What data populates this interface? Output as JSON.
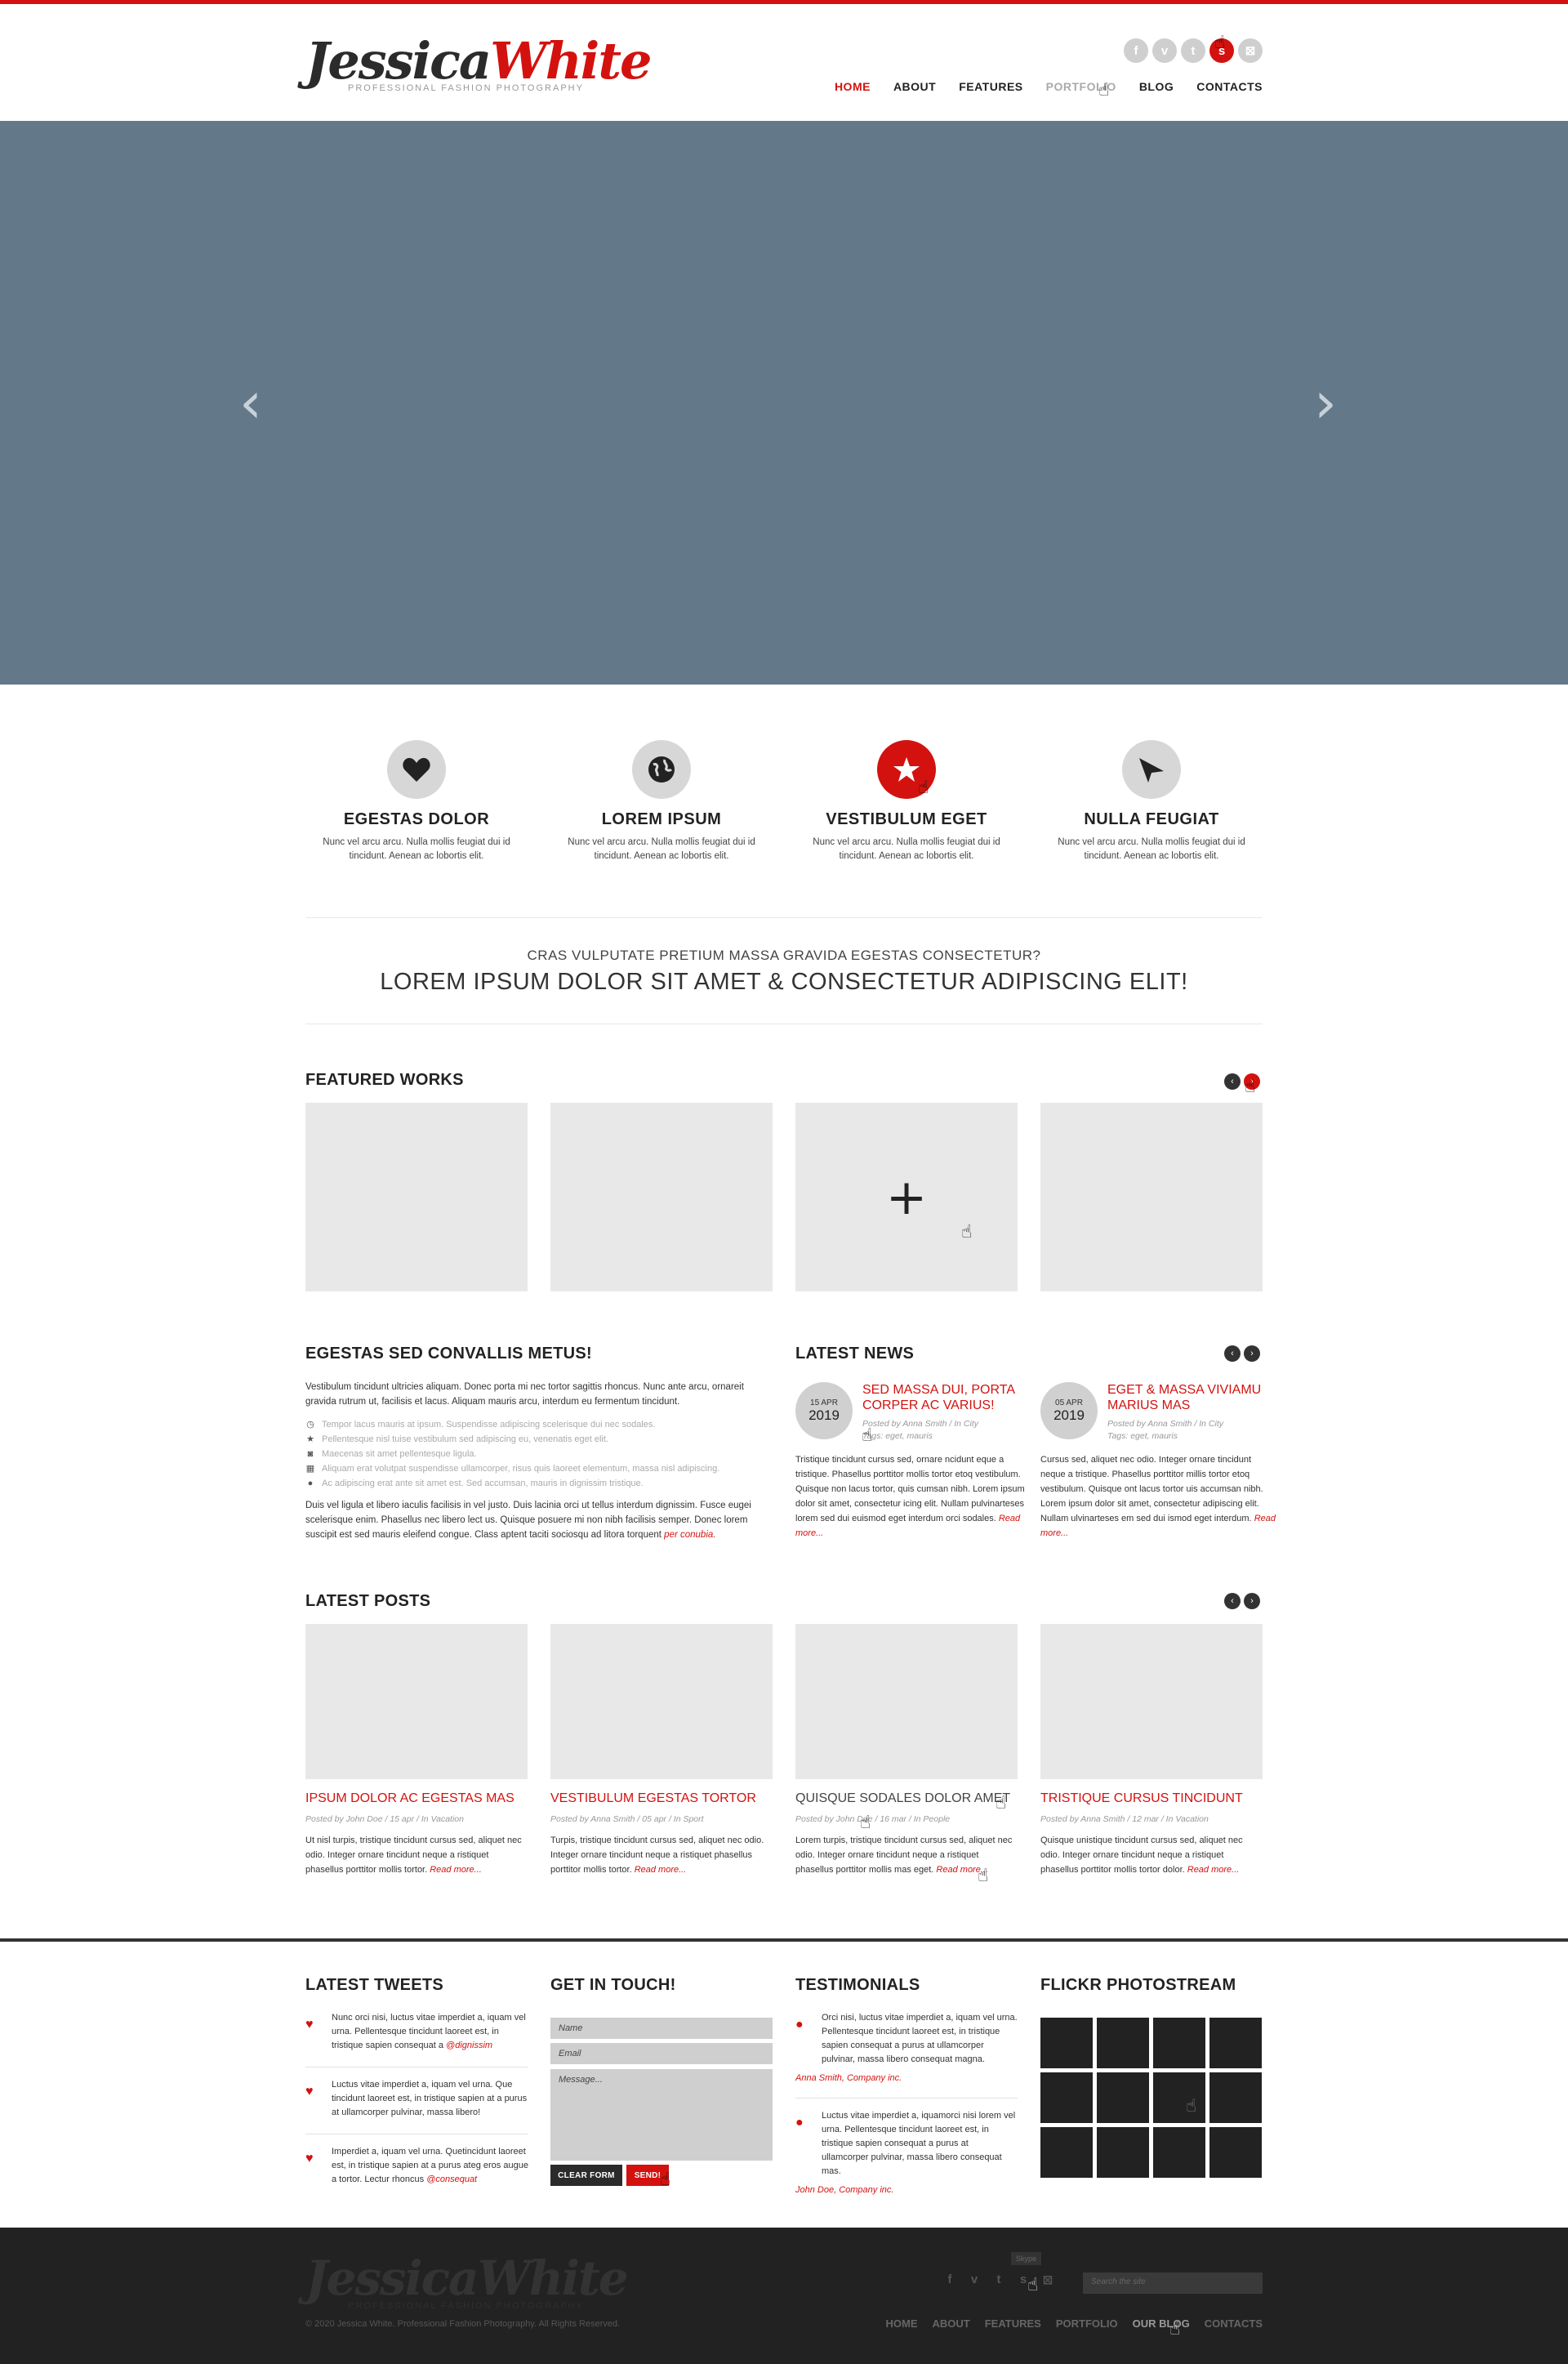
{
  "brand": {
    "logo_first": "Jessica",
    "logo_second": "White",
    "tagline": "PROFESSIONAL FASHION PHOTOGRAPHY",
    "accent": "#d3120f"
  },
  "header": {
    "socials": [
      {
        "icon": "facebook-icon",
        "glyph": "f"
      },
      {
        "icon": "vimeo-icon",
        "glyph": "v"
      },
      {
        "icon": "tumblr-icon",
        "glyph": "t"
      },
      {
        "icon": "skype-icon",
        "glyph": "s"
      },
      {
        "icon": "flickr-icon",
        "glyph": "⊠"
      }
    ],
    "nav": [
      "HOME",
      "ABOUT",
      "FEATURES",
      "PORTFOLIO",
      "BLOG",
      "CONTACTS"
    ]
  },
  "slider": {
    "prev": "‹",
    "next": "›",
    "bg": "#637888"
  },
  "features": [
    {
      "icon": "heart-icon",
      "title": "EGESTAS DOLOR",
      "text": "Nunc vel arcu arcu. Nulla mollis feugiat dui id tincidunt. Aenean ac lobortis elit."
    },
    {
      "icon": "globe-icon",
      "title": "LOREM IPSUM",
      "text": "Nunc vel arcu arcu. Nulla mollis feugiat dui id tincidunt. Aenean ac lobortis elit."
    },
    {
      "icon": "star-icon",
      "title": "VESTIBULUM EGET",
      "text": "Nunc vel arcu arcu. Nulla mollis feugiat dui id tincidunt. Aenean ac lobortis elit."
    },
    {
      "icon": "paper-plane-icon",
      "title": "NULLA FEUGIAT",
      "text": "Nunc vel arcu arcu. Nulla mollis feugiat dui id tincidunt. Aenean ac lobortis elit."
    }
  ],
  "tagline": {
    "sub": "CRAS VULPUTATE PRETIUM MASSA GRAVIDA EGESTAS CONSECTETUR?",
    "main": "LOREM IPSUM DOLOR SIT AMET & CONSECTETUR ADIPISCING ELIT!"
  },
  "featured": {
    "title": "FEATURED WORKS",
    "plus": "+"
  },
  "about": {
    "title": "EGESTAS SED CONVALLIS METUS!",
    "intro": "Vestibulum tincidunt ultricies aliquam. Donec porta mi nec tortor sagittis rhoncus. Nunc ante arcu, ornareit gravida rutrum ut, facilisis et lacus. Aliquam mauris arcu, interdum eu fermentum tincidunt.",
    "list": [
      {
        "icon": "clock-icon",
        "glyph": "◷",
        "text": "Tempor lacus mauris at ipsum. Suspendisse adipiscing scelerisque dui nec sodales."
      },
      {
        "icon": "star-icon",
        "glyph": "★",
        "text": "Pellentesque nisl tuise vestibulum sed adipiscing eu, venenatis eget elit."
      },
      {
        "icon": "camera-icon",
        "glyph": "◙",
        "text": "Maecenas sit amet pellentesque ligula."
      },
      {
        "icon": "qr-icon",
        "glyph": "▦",
        "text": "Aliquam erat volutpat suspendisse ullamcorper, risus quis laoreet elementum, massa nisl adipiscing."
      },
      {
        "icon": "user-icon",
        "glyph": "●",
        "text": "Ac adipiscing erat ante sit amet est. Sed accumsan, mauris in dignissim tristique."
      }
    ],
    "outro": "Duis vel ligula et libero iaculis facilisis in vel justo. Duis lacinia orci ut tellus interdum dignissim. Fusce eugei scelerisque enim. Phasellus nec libero lect us. Quisque posuere mi non nibh facilisis semper. Donec lorem suscipit est sed mauris eleifend congue. Class aptent taciti sociosqu ad litora torquent",
    "outro_link": "per conubia."
  },
  "news": {
    "title": "LATEST NEWS",
    "items": [
      {
        "day": "15 APR",
        "year": "2019",
        "title": "SED MASSA DUI, PORTA CORPER AC VARIUS!",
        "meta": "Posted by Anna Smith  /  In City",
        "tags": "Tags: eget, mauris",
        "text": "Tristique tincidunt cursus sed, ornare ncidunt eque a tristique. Phasellus porttitor mollis tortor etoq vestibulum. Quisque non lacus tortor, quis cumsan nibh. Lorem ipsum dolor sit amet, consectetur icing elit. Nullam pulvinarteses lorem sed dui euismod eget interdum orci sodales.",
        "more": "Read more..."
      },
      {
        "day": "05 APR",
        "year": "2019",
        "title": "EGET & MASSA VIVIAMU MARIUS MAS",
        "meta": "Posted by Anna Smith  /  In City",
        "tags": "Tags: eget, mauris",
        "text": "Cursus sed, aliquet nec odio. Integer ornare tincidunt neque a tristique. Phasellus porttitor millis tortor etoq vestibulum. Quisque ont lacus tortor uis accumsan nibh. Lorem ipsum dolor sit amet, consectetur adipiscing elit. Nullam ulvinarteses em sed dui ismod eget interdum.",
        "more": "Read more..."
      }
    ]
  },
  "posts": {
    "title": "LATEST POSTS",
    "items": [
      {
        "title": "IPSUM DOLOR AC EGESTAS MAS",
        "meta": "Posted by John Doe  /  15 apr  /  In Vacation",
        "text": "Ut nisl turpis, tristique tincidunt cursus sed, aliquet nec odio. Integer ornare tincidunt neque a ristiquet phasellus porttitor mollis tortor.",
        "more": "Read more..."
      },
      {
        "title": "VESTIBULUM EGESTAS TORTOR",
        "meta": "Posted by Anna Smith  /  05 apr  /  In Sport",
        "text": "Turpis, tristique tincidunt cursus sed, aliquet nec odio. Integer ornare tincidunt neque a ristiquet phasellus porttitor mollis tortor.",
        "more": "Read more..."
      },
      {
        "title": "QUISQUE SODALES DOLOR AMET",
        "meta": "Posted by John Doe  /  16 mar  /  In People",
        "text": "Lorem turpis, tristique tincidunt cursus sed, aliquet nec odio. Integer ornare tincidunt neque a ristiquet phasellus porttitor mollis mas eget.",
        "more": "Read more..."
      },
      {
        "title": "TRISTIQUE CURSUS TINCIDUNT",
        "meta": "Posted by Anna Smith  /  12 mar  /  In Vacation",
        "text": "Quisque unistique tincidunt cursus sed, aliquet nec odio. Integer ornare tincidunt neque a ristiquet phasellus porttitor mollis tortor dolor.",
        "more": "Read more..."
      }
    ]
  },
  "tweets": {
    "title": "LATEST TWEETS",
    "items": [
      {
        "text": "Nunc orci nisi, luctus vitae imperdiet a, iquam vel urna. Pellentesque tincidunt laoreet est, in tristique sapien consequat a",
        "handle": "@dignissim"
      },
      {
        "text": "Luctus vitae imperdiet a, iquam vel urna. Que tincidunt laoreet est, in tristique sapien at a purus at ullamcorper pulvinar, massa libero!",
        "handle": ""
      },
      {
        "text": "Imperdiet a, iquam vel urna. Quetincidunt laoreet est, in tristique sapien at a purus ateg eros augue a tortor. Lectur rhoncus",
        "handle": "@consequat"
      }
    ]
  },
  "contact": {
    "title": "GET IN TOUCH!",
    "name_placeholder": "Name",
    "email_placeholder": "Email",
    "message_placeholder": "Message...",
    "clear": "CLEAR FORM",
    "send": "SEND!"
  },
  "testimonials": {
    "title": "TESTIMONIALS",
    "items": [
      {
        "text": "Orci nisi, luctus vitae imperdiet a, iquam vel urna. Pellentesque tincidunt laoreet est, in tristique sapien consequat a purus at ullamcorper pulvinar, massa libero consequat magna.",
        "author": "Anna Smith, Company inc."
      },
      {
        "text": "Luctus vitae imperdiet a, iquamorci nisi lorem vel urna. Pellentesque tincidunt laoreet est, in tristique sapien consequat a purus at ullamcorper pulvinar, massa libero consequat mas.",
        "author": "John Doe, Company inc."
      }
    ]
  },
  "flickr": {
    "title": "FLICKR PHOTOSTREAM"
  },
  "footer": {
    "copyright": "© 2020 Jessica White. Professional Fashion Photography. All Rights Reserved.",
    "tooltip": "Skype",
    "search_placeholder": "Search the site",
    "socials": [
      "f",
      "v",
      "t",
      "s",
      "⊠"
    ],
    "nav": [
      "HOME",
      "ABOUT",
      "FEATURES",
      "PORTFOLIO",
      "OUR BLOG",
      "CONTACTS"
    ]
  }
}
